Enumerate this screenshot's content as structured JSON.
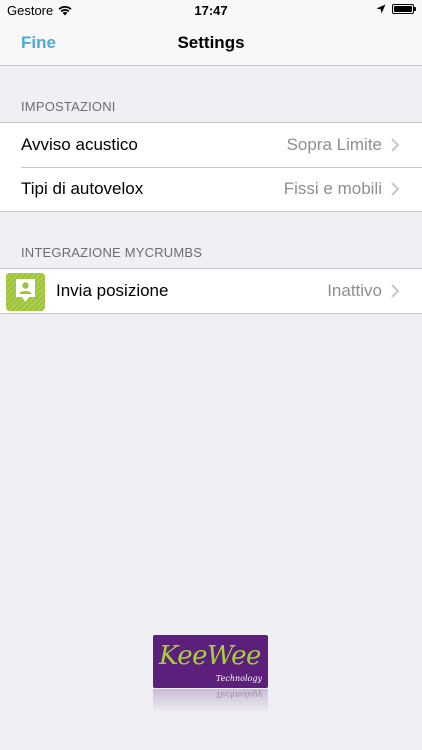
{
  "status_bar": {
    "carrier": "Gestore",
    "time": "17:47",
    "wifi_icon": "wifi-icon",
    "location_icon": "location-arrow-icon",
    "battery_level": 1.0
  },
  "nav": {
    "done_label": "Fine",
    "title": "Settings"
  },
  "sections": {
    "impostazioni": {
      "header": "IMPOSTAZIONI",
      "rows": [
        {
          "label": "Avviso acustico",
          "value": "Sopra Limite"
        },
        {
          "label": "Tipi di autovelox",
          "value": "Fissi e mobili"
        }
      ]
    },
    "mycrumbs": {
      "header": "INTEGRAZIONE MYCRUMBS",
      "rows": [
        {
          "label": "Invia posizione",
          "value": "Inattivo",
          "icon": "mycrumbs-app-icon"
        }
      ]
    }
  },
  "logo": {
    "name": "KeeWee",
    "subtitle": "Technology",
    "colors": {
      "background": "#5d1f7c",
      "text": "#a6cf3a"
    }
  },
  "colors": {
    "accent": "#4fa8dc",
    "background": "#efeff4",
    "secondary_text": "#8e8e93"
  }
}
